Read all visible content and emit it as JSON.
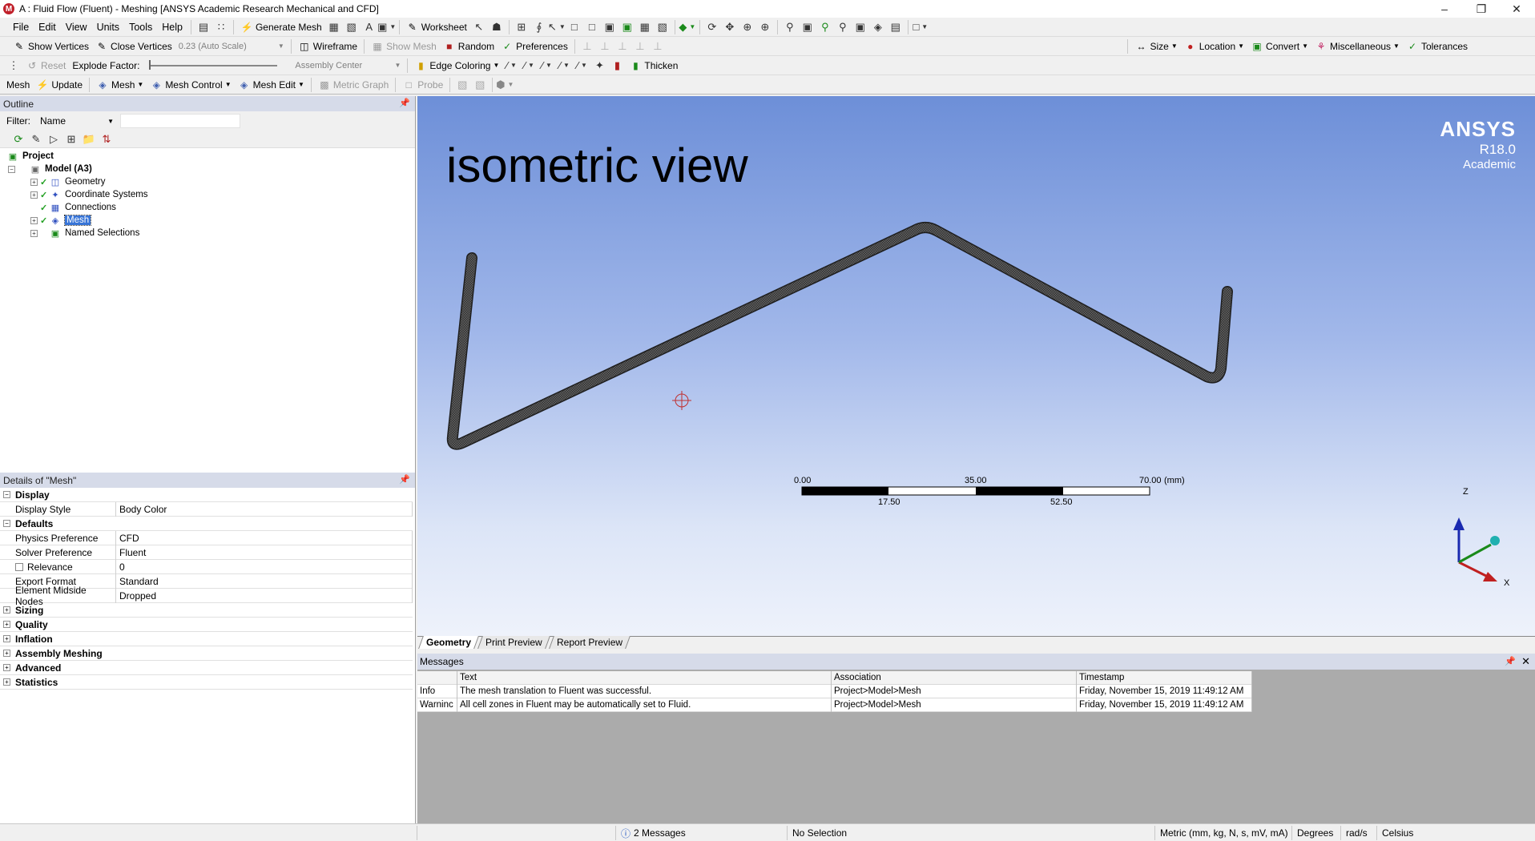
{
  "window": {
    "title": "A : Fluid Flow (Fluent) - Meshing [ANSYS Academic Research Mechanical and CFD]",
    "app_icon_letter": "M"
  },
  "menu": [
    "File",
    "Edit",
    "View",
    "Units",
    "Tools",
    "Help"
  ],
  "toolbar1": {
    "generate_mesh": "Generate Mesh",
    "worksheet": "Worksheet"
  },
  "toolbar2": {
    "show_vertices": "Show Vertices",
    "close_vertices": "Close Vertices",
    "scale_value": "0.23 (Auto Scale)",
    "wireframe": "Wireframe",
    "show_mesh": "Show Mesh",
    "random": "Random",
    "preferences": "Preferences",
    "size": "Size",
    "location": "Location",
    "convert": "Convert",
    "miscellaneous": "Miscellaneous",
    "tolerances": "Tolerances"
  },
  "toolbar3": {
    "reset": "Reset",
    "explode_factor": "Explode Factor:",
    "assembly_center": "Assembly Center",
    "edge_coloring": "Edge Coloring",
    "thicken": "Thicken"
  },
  "toolbar4": {
    "mesh_label": "Mesh",
    "update": "Update",
    "mesh": "Mesh",
    "mesh_control": "Mesh Control",
    "mesh_edit": "Mesh Edit",
    "metric_graph": "Metric Graph",
    "probe": "Probe"
  },
  "outline": {
    "header": "Outline",
    "filter_label": "Filter:",
    "filter_value": "Name",
    "tree": {
      "project": "Project",
      "model": "Model (A3)",
      "geometry": "Geometry",
      "coordinate_systems": "Coordinate Systems",
      "connections": "Connections",
      "mesh": "Mesh",
      "named_selections": "Named Selections"
    }
  },
  "details": {
    "header": "Details of \"Mesh\"",
    "groups": {
      "display": "Display",
      "defaults": "Defaults",
      "sizing": "Sizing",
      "quality": "Quality",
      "inflation": "Inflation",
      "assembly_meshing": "Assembly Meshing",
      "advanced": "Advanced",
      "statistics": "Statistics"
    },
    "rows": {
      "display_style_key": "Display Style",
      "display_style_val": "Body Color",
      "physics_pref_key": "Physics Preference",
      "physics_pref_val": "CFD",
      "solver_pref_key": "Solver Preference",
      "solver_pref_val": "Fluent",
      "relevance_key": "Relevance",
      "relevance_val": "0",
      "export_format_key": "Export Format",
      "export_format_val": "Standard",
      "midside_key": "Element Midside Nodes",
      "midside_val": "Dropped"
    }
  },
  "viewport": {
    "view_label": "isometric view",
    "logo": {
      "brand": "ANSYS",
      "version": "R18.0",
      "edition": "Academic"
    },
    "scale": {
      "t0": "0.00",
      "t35": "35.00",
      "t70": "70.00",
      "unit": "(mm)",
      "t17": "17.50",
      "t52": "52.50"
    },
    "axes": {
      "z": "Z",
      "x": "X"
    }
  },
  "view_tabs": [
    "Geometry",
    "Print Preview",
    "Report Preview"
  ],
  "messages": {
    "header": "Messages",
    "columns": [
      "",
      "Text",
      "Association",
      "Timestamp"
    ],
    "rows": [
      {
        "type": "Info",
        "text": "The mesh translation to Fluent was successful.",
        "assoc": "Project>Model>Mesh",
        "time": "Friday, November 15, 2019 11:49:12 AM"
      },
      {
        "type": "Warninc",
        "text": "All cell zones in Fluent may be automatically set to Fluid.",
        "assoc": "Project>Model>Mesh",
        "time": "Friday, November 15, 2019 11:49:12 AM"
      }
    ]
  },
  "status": {
    "messages": "2 Messages",
    "selection": "No Selection",
    "units": "Metric (mm, kg, N, s, mV, mA)",
    "angle": "Degrees",
    "rate": "rad/s",
    "temp": "Celsius"
  },
  "colors": {
    "viewport_top": "#6d8fd8",
    "viewport_bottom": "#eef2fb",
    "panel_header": "#d6dbe9",
    "selection": "#3875d7",
    "check_green": "#22a022"
  }
}
